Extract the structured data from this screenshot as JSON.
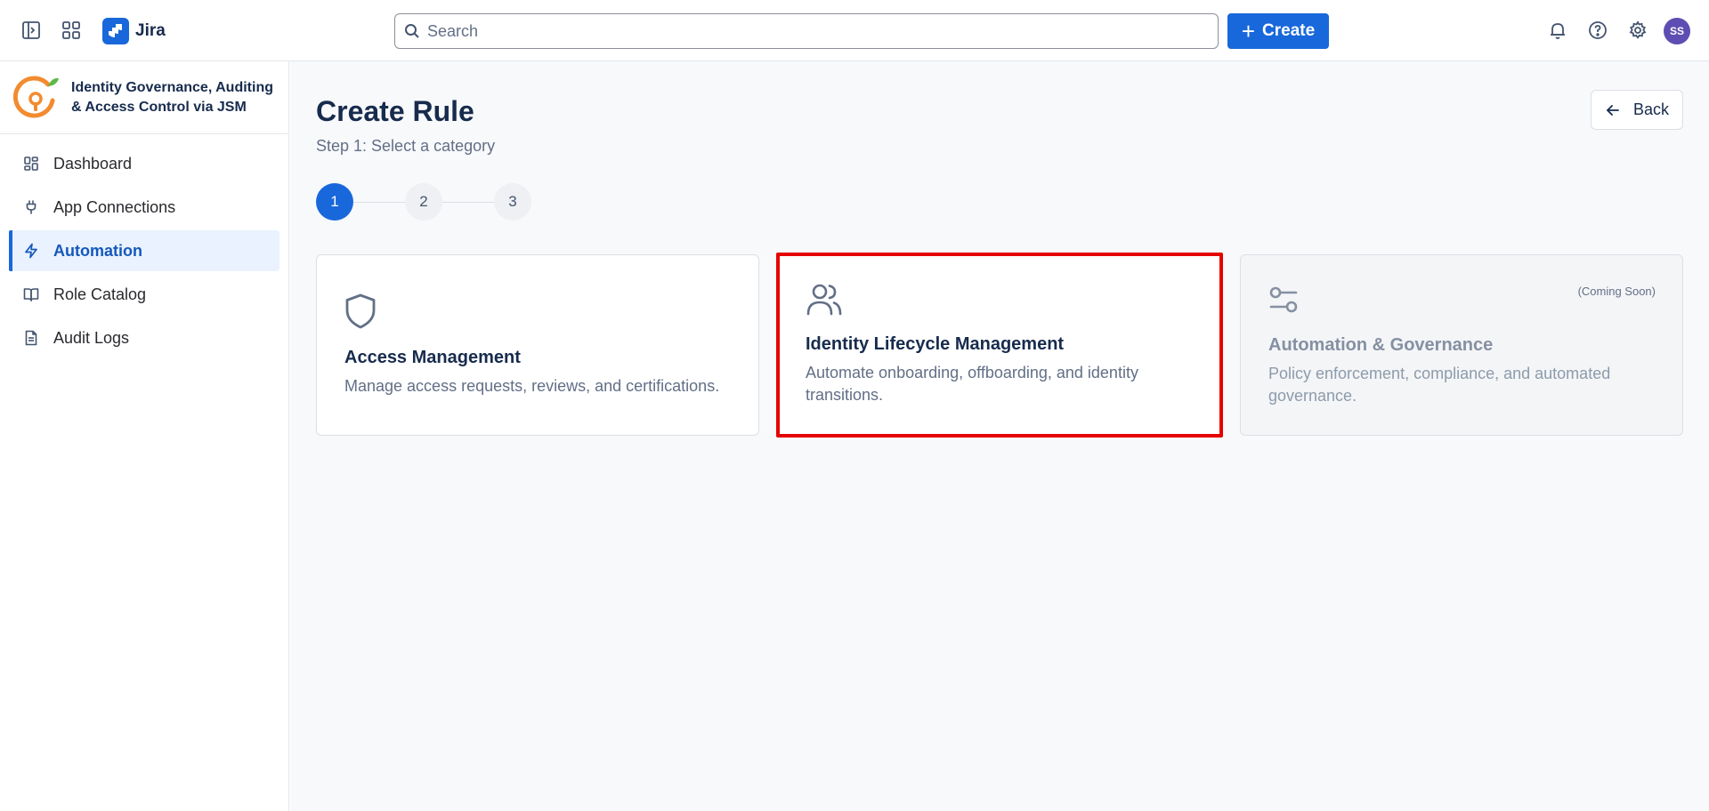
{
  "topbar": {
    "product_name": "Jira",
    "search_placeholder": "Search",
    "create_label": "Create",
    "avatar_initials": "SS"
  },
  "sidebar": {
    "app_title": "Identity Governance, Auditing & Access Control via JSM",
    "items": [
      {
        "label": "Dashboard",
        "icon": "dashboard-icon",
        "active": false
      },
      {
        "label": "App Connections",
        "icon": "plug-icon",
        "active": false
      },
      {
        "label": "Automation",
        "icon": "lightning-icon",
        "active": true
      },
      {
        "label": "Role Catalog",
        "icon": "book-icon",
        "active": false
      },
      {
        "label": "Audit Logs",
        "icon": "document-icon",
        "active": false
      }
    ]
  },
  "main": {
    "title": "Create Rule",
    "subtitle": "Step 1: Select a category",
    "back_label": "Back",
    "steps": [
      "1",
      "2",
      "3"
    ],
    "current_step": 1,
    "cards": [
      {
        "title": "Access Management",
        "description": "Manage access requests, reviews, and certifications.",
        "icon": "shield-icon",
        "badge": ""
      },
      {
        "title": "Identity Lifecycle Management",
        "description": "Automate onboarding, offboarding, and identity transitions.",
        "icon": "users-icon",
        "badge": ""
      },
      {
        "title": "Automation & Governance",
        "description": "Policy enforcement, compliance, and automated governance.",
        "icon": "toggles-icon",
        "badge": "(Coming Soon)"
      }
    ]
  },
  "colors": {
    "brand": "#1868db",
    "highlight_border": "#e60000",
    "active_nav_bg": "#e9f2fe",
    "avatar_bg": "#5e4db2",
    "app_logo": "#f28b30"
  }
}
